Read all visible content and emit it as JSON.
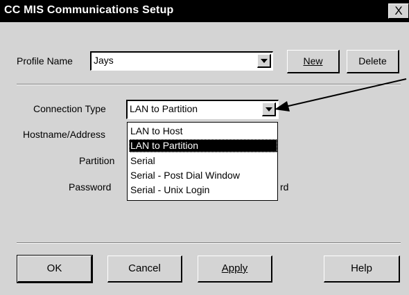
{
  "window": {
    "title": "CC MIS Communications Setup",
    "close_label": "X"
  },
  "profile": {
    "label": "Profile Name",
    "value": "Jays",
    "new_label": "New",
    "delete_label": "Delete"
  },
  "connection": {
    "type_label": "Connection Type",
    "type_value": "LAN to Partition",
    "hostname_label": "Hostname/Address",
    "partition_label": "Partition",
    "password_label": "Password",
    "password_trailing": "rd",
    "options": [
      "LAN to Host",
      "LAN to Partition",
      "Serial",
      "Serial - Post Dial Window",
      "Serial - Unix Login"
    ],
    "selected_index": 1
  },
  "buttons": {
    "ok": "OK",
    "cancel": "Cancel",
    "apply": "Apply",
    "help": "Help"
  }
}
